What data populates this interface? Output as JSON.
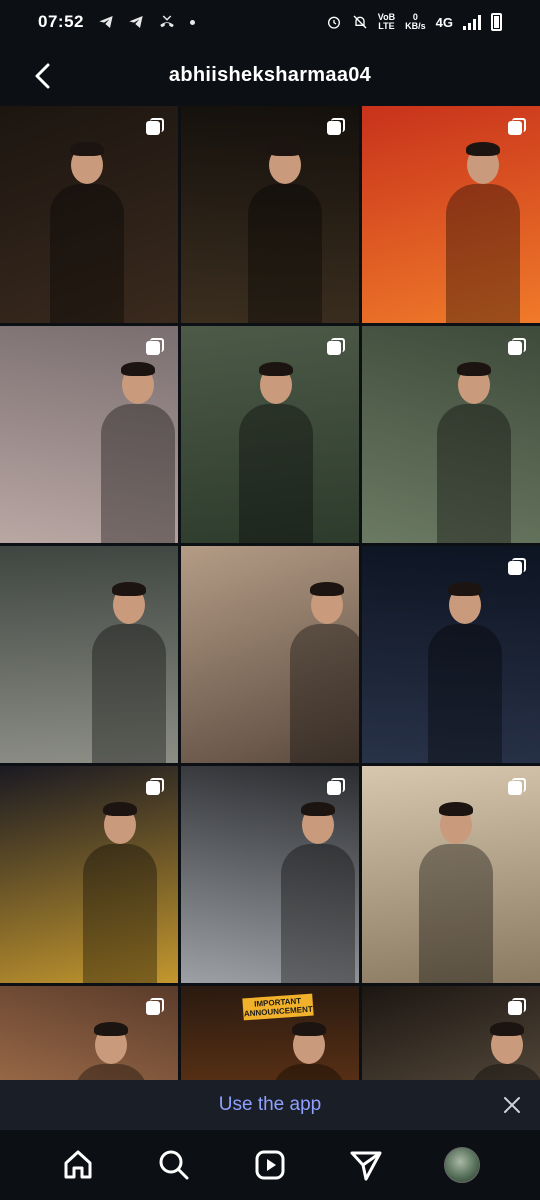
{
  "status_bar": {
    "time": "07:52",
    "notif_icons": [
      "telegram-icon",
      "telegram-icon",
      "missed-call-icon",
      "dot-icon"
    ],
    "volte_top": "VoB",
    "volte_bottom": "LTE",
    "speed_value": "0",
    "speed_unit": "KB/s",
    "network": "4G"
  },
  "header": {
    "username": "abhiisheksharmaa04"
  },
  "grid": {
    "posts": [
      {
        "colors": [
          "#1c1510",
          "#3a2a1e"
        ],
        "multi": true
      },
      {
        "colors": [
          "#14100c",
          "#3b2e1f"
        ],
        "multi": true
      },
      {
        "colors": [
          "#c8321b",
          "#f07a2a"
        ],
        "multi": true
      },
      {
        "colors": [
          "#7a6e70",
          "#b9a7a3"
        ],
        "multi": true
      },
      {
        "colors": [
          "#4d5a48",
          "#2d3b2c"
        ],
        "multi": true
      },
      {
        "colors": [
          "#3e4a3a",
          "#6b7a63"
        ],
        "multi": true
      },
      {
        "colors": [
          "#3f4540",
          "#8c8e86"
        ],
        "multi": false
      },
      {
        "colors": [
          "#b49c86",
          "#5b4a3e"
        ],
        "multi": false
      },
      {
        "colors": [
          "#0d1422",
          "#283248"
        ],
        "multi": true
      },
      {
        "colors": [
          "#1b1a22",
          "#c3972e"
        ],
        "multi": true
      },
      {
        "colors": [
          "#2a2c30",
          "#9da0a4"
        ],
        "multi": true
      },
      {
        "colors": [
          "#d7c7ae",
          "#8a7a62"
        ],
        "multi": true
      },
      {
        "colors": [
          "#5a3b2a",
          "#c98c5e"
        ],
        "multi": true
      },
      {
        "colors": [
          "#2a1a10",
          "#8e4a1a"
        ],
        "multi": false,
        "announcement": "IMPORTANT ANNOUNCEMENT"
      },
      {
        "colors": [
          "#1c1612",
          "#7a6a55"
        ],
        "multi": true
      }
    ]
  },
  "banner": {
    "text": "Use the app"
  },
  "nav": [
    "home-icon",
    "search-icon",
    "reels-icon",
    "direct-message-icon",
    "profile-avatar"
  ],
  "colors": {
    "background": "#0c0f14",
    "banner_bg": "#1a1e26",
    "banner_text": "#8fa0ff"
  }
}
